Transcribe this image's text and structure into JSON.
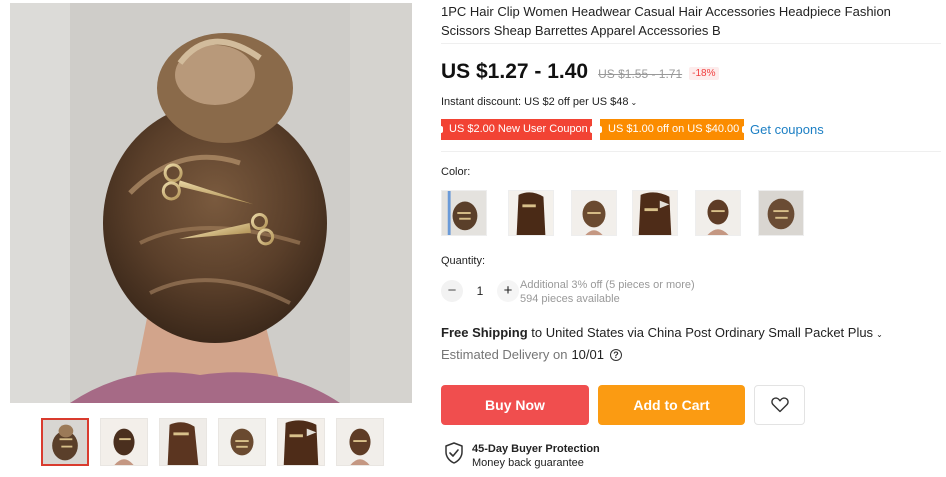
{
  "product": {
    "title": "1PC Hair Clip Women Headwear Casual Hair Accessories Headpiece Fashion Scissors Sheap Barrettes Apparel Accessories B",
    "price": "US $1.27 - 1.40",
    "original_price": "US $1.55 - 1.71",
    "discount": "-18%"
  },
  "promotions": {
    "instant_discount": "Instant discount: US $2 off per US $48",
    "coupon_new_user": "US $2.00 New User Coupon",
    "coupon_store": "US $1.00 off on US $40.00",
    "get_coupons": "Get coupons"
  },
  "color": {
    "label": "Color:",
    "selected_index": 0,
    "swatch_count": 6
  },
  "gallery": {
    "thumbnail_count": 6,
    "active_index": 0
  },
  "quantity": {
    "label": "Quantity:",
    "decrease": "−",
    "value": "1",
    "increase": "+",
    "bulk_note": "Additional 3% off (5 pieces or more)",
    "available": "594 pieces available"
  },
  "shipping": {
    "free_label": "Free Shipping",
    "destination": "to United States via China Post Ordinary Small Packet Plus",
    "estimated_label": "Estimated Delivery on",
    "estimated_date": "10/01"
  },
  "actions": {
    "buy_now": "Buy Now",
    "add_to_cart": "Add to Cart"
  },
  "protection": {
    "title": "45-Day Buyer Protection",
    "subtitle": "Money back guarantee"
  },
  "colors": {
    "buy_now": "#f04e4e",
    "add_to_cart": "#fb9b12",
    "coupon_red": "#f24334",
    "coupon_orange": "#fb8c00",
    "link": "#1c7fc4",
    "discount_badge": "#f03d3d"
  },
  "icons": {
    "wishlist": "heart-icon",
    "help": "question-circle-icon",
    "protection": "shield-check-icon",
    "dropdown": "chevron-down-icon"
  }
}
